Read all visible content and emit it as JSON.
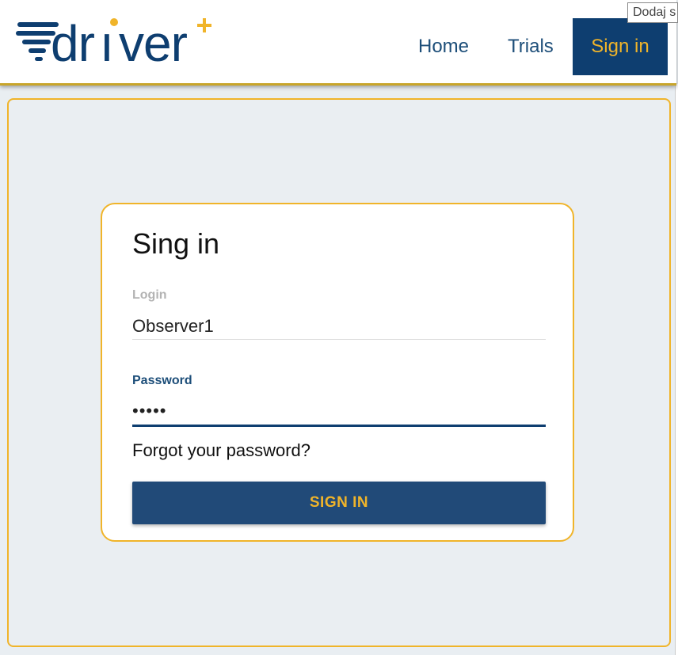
{
  "header": {
    "logo_alt": "driver+",
    "nav": {
      "home": "Home",
      "trials": "Trials",
      "sign_in": "Sign in"
    },
    "tooltip": "Dodaj s"
  },
  "signin_card": {
    "title": "Sing in",
    "login": {
      "label": "Login",
      "value": "Observer1"
    },
    "password": {
      "label": "Password",
      "value": "•••••"
    },
    "forgot_link": "Forgot your password?",
    "submit_label": "SIGN IN"
  },
  "colors": {
    "brand_blue": "#0e3e70",
    "accent_gold": "#f0b42a",
    "button_blue": "#214a78",
    "page_bg": "#eaeef2"
  },
  "icons": {
    "logo": "driver-plus-logo",
    "speed_lines": "speed-lines-icon"
  }
}
